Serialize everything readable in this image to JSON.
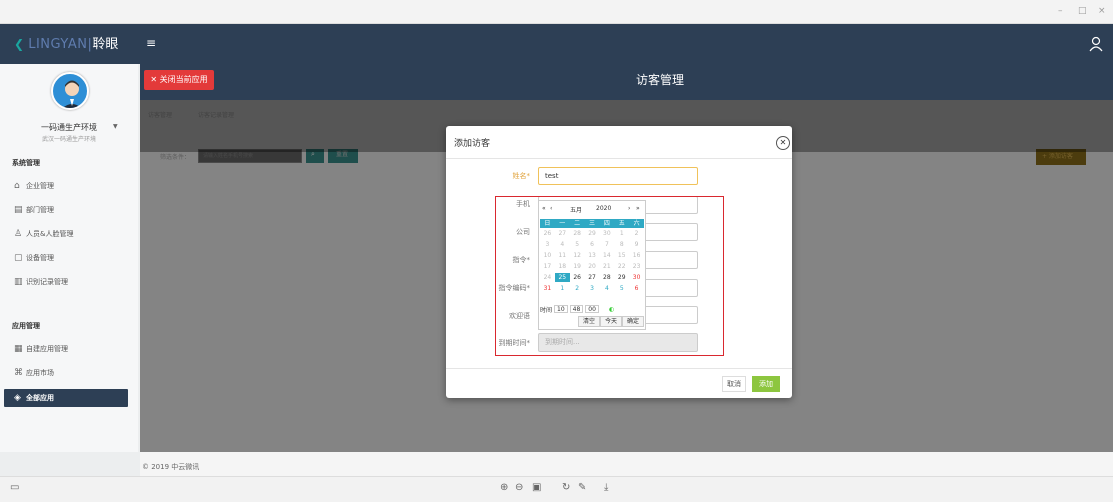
{
  "window": {
    "controls": [
      "–",
      "□",
      "×"
    ]
  },
  "header": {
    "logo_text": "LINGYAN",
    "logo_sep": "|",
    "logo_cn": "聆眼",
    "menu_icon": "menu-icon",
    "user_icon": "user-icon",
    "close_app_label": "关闭当前应用",
    "page_title": "访客管理"
  },
  "sidebar": {
    "user_name": "一码通生产环境",
    "user_sub": "武汉一码通生产环境",
    "sections": [
      {
        "title": "系统管理",
        "items": [
          {
            "label": "企业管理",
            "icon": "home-icon"
          },
          {
            "label": "部门管理",
            "icon": "department-icon"
          },
          {
            "label": "人员&人脸管理",
            "icon": "person-icon"
          },
          {
            "label": "设备管理",
            "icon": "device-icon"
          },
          {
            "label": "识别记录管理",
            "icon": "record-icon"
          }
        ]
      },
      {
        "title": "应用管理",
        "items": [
          {
            "label": "自建应用管理",
            "icon": "grid-icon"
          },
          {
            "label": "应用市场",
            "icon": "market-icon"
          },
          {
            "label": "全部应用",
            "icon": "cube-icon",
            "active": true
          }
        ]
      }
    ]
  },
  "background_page": {
    "tabs": [
      "访客管理",
      "访客记录管理"
    ],
    "filter_label": "筛选条件：",
    "filter_placeholder": "请输入姓名手机号搜索",
    "reset_label": "重置",
    "add_label": "+ 添加访客"
  },
  "modal": {
    "title": "添加访客",
    "fields": [
      {
        "label": "姓名*",
        "value": "test",
        "required": true
      },
      {
        "label": "手机",
        "value": ""
      },
      {
        "label": "公司",
        "value": ""
      },
      {
        "label": "指令*",
        "value": ""
      },
      {
        "label": "指令编码*",
        "value": ""
      },
      {
        "label": "欢迎语",
        "value": ""
      },
      {
        "label": "到期时间*",
        "value": "",
        "placeholder": "到期时间..."
      }
    ],
    "cancel_label": "取消",
    "submit_label": "添加"
  },
  "calendar": {
    "prev_year": "«",
    "prev_month": "‹",
    "month": "五月",
    "year": "2020",
    "next_month": "›",
    "next_year": "»",
    "weekdays": [
      "日",
      "一",
      "二",
      "三",
      "四",
      "五",
      "六"
    ],
    "weeks": [
      [
        "26",
        "27",
        "28",
        "29",
        "30",
        "1",
        "2"
      ],
      [
        "3",
        "4",
        "5",
        "6",
        "7",
        "8",
        "9"
      ],
      [
        "10",
        "11",
        "12",
        "13",
        "14",
        "15",
        "16"
      ],
      [
        "17",
        "18",
        "19",
        "20",
        "21",
        "22",
        "23"
      ],
      [
        "24",
        "25",
        "26",
        "27",
        "28",
        "29",
        "30"
      ],
      [
        "31",
        "1",
        "2",
        "3",
        "4",
        "5",
        "6"
      ]
    ],
    "selected": "25",
    "time_label": "时间",
    "hour": "10",
    "minute": "48",
    "second": "00",
    "btn_clear": "清空",
    "btn_today": "今天",
    "btn_confirm": "确定"
  },
  "footer": {
    "copyright": "© 2019 中云微讯"
  },
  "bottombar": {
    "icons": [
      "screen-icon",
      "zoom-in-icon",
      "zoom-out-icon",
      "fit-icon",
      "rotate-icon",
      "edit-icon",
      "download-icon"
    ]
  }
}
